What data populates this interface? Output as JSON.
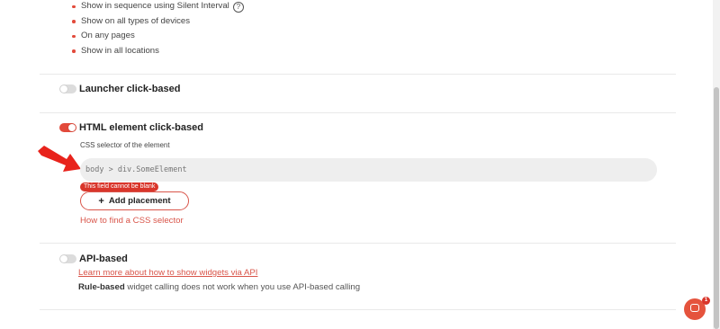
{
  "top_list": {
    "items": [
      {
        "text": "Show in sequence using Silent Interval",
        "help_icon": "?"
      },
      {
        "text": "Show on all types of devices"
      },
      {
        "text": "On any pages"
      },
      {
        "text": "Show in all locations"
      }
    ]
  },
  "launcher": {
    "title": "Launcher click-based",
    "enabled": false
  },
  "html_element": {
    "title": "HTML element click-based",
    "enabled": true,
    "selector_label": "CSS selector of the element",
    "selector_placeholder": "body > div.SomeElement",
    "selector_value": "",
    "error": "This field cannot be blank",
    "add_placement": "Add placement",
    "add_placement_icon": "plus-icon",
    "help_link": "How to find a CSS selector"
  },
  "api": {
    "title": "API-based",
    "enabled": false,
    "learn_more": "Learn more about how to show widgets via API",
    "note_bold": "Rule-based",
    "note_rest": " widget calling does not work when you use API-based calling"
  },
  "chat": {
    "icon": "chat-icon",
    "badge": "1"
  },
  "colors": {
    "accent": "#e24a3b",
    "error": "#d9362b"
  }
}
